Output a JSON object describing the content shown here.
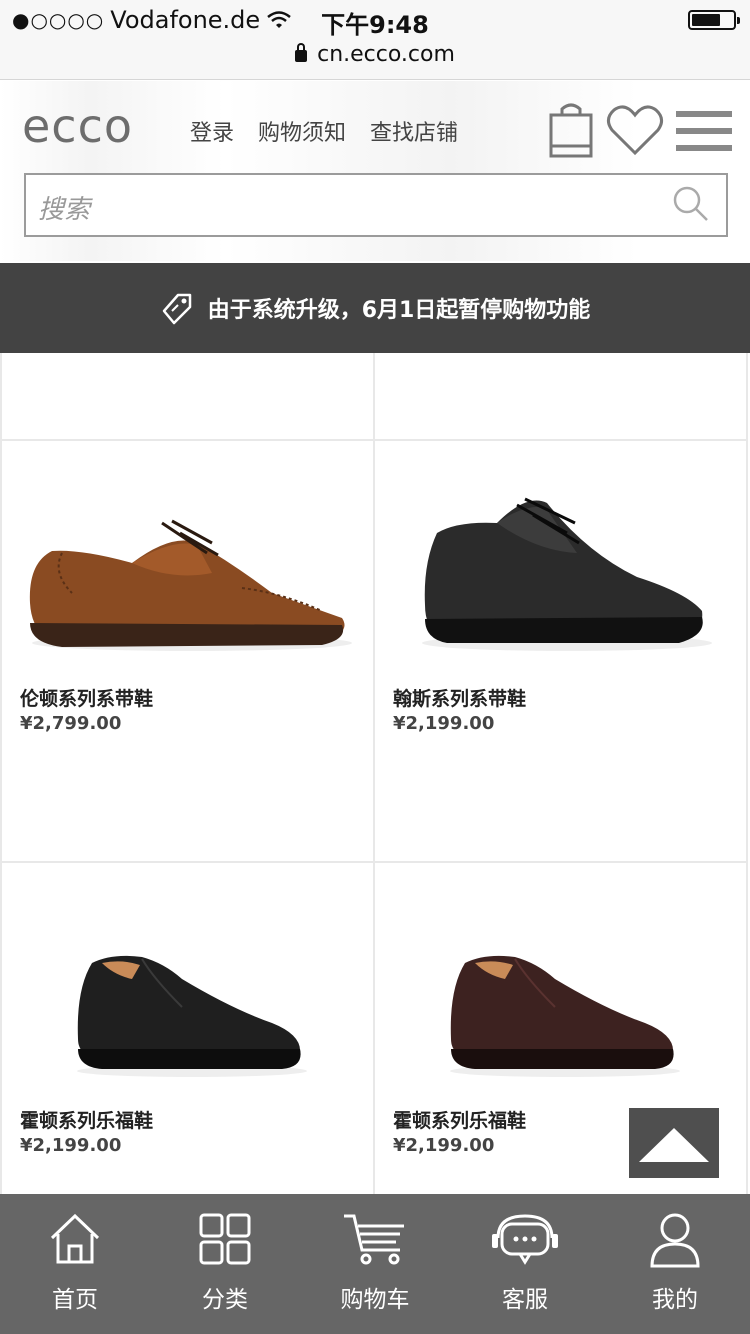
{
  "status_bar": {
    "signal_dots": "●○○○○",
    "carrier": "Vodafone.de",
    "time": "下午9:48",
    "battery_level": 0.7
  },
  "url_bar": {
    "url": "cn.ecco.com"
  },
  "header": {
    "logo": "ecco",
    "nav": [
      "登录",
      "购物须知",
      "查找店铺"
    ],
    "search_placeholder": "搜索"
  },
  "banner": {
    "text": "由于系统升级，6月1日起暂停购物功能"
  },
  "products": [
    {
      "name": "伦顿系列系带鞋",
      "price": "¥2,799.00",
      "color": "#8a4b22"
    },
    {
      "name": "翰斯系列系带鞋",
      "price": "¥2,199.00",
      "color": "#2b2b2b"
    },
    {
      "name": "霍顿系列乐福鞋",
      "price": "¥2,199.00",
      "color": "#1f1f1f"
    },
    {
      "name": "霍顿系列乐福鞋",
      "price": "¥2,199.00",
      "color": "#3d2220"
    }
  ],
  "tabbar": {
    "tabs": [
      {
        "label": "首页",
        "icon": "home-icon"
      },
      {
        "label": "分类",
        "icon": "category-icon"
      },
      {
        "label": "购物车",
        "icon": "cart-icon"
      },
      {
        "label": "客服",
        "icon": "chat-icon"
      },
      {
        "label": "我的",
        "icon": "user-icon"
      }
    ]
  },
  "colors": {
    "banner_bg": "#434343",
    "tabbar_bg": "#666666",
    "accent": "#ffffff"
  }
}
